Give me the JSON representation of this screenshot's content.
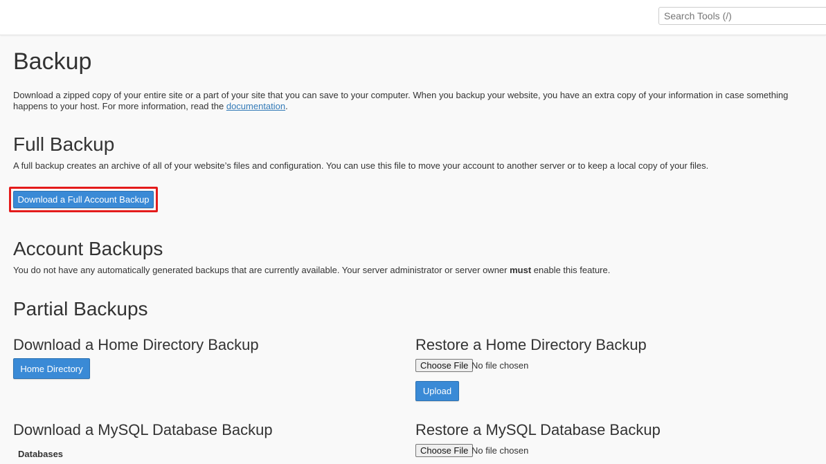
{
  "header": {
    "search_placeholder": "Search Tools (/)"
  },
  "page": {
    "title": "Backup",
    "intro_text": "Download a zipped copy of your entire site or a part of your site that you can save to your computer. When you backup your website, you have an extra copy of your information in case something",
    "intro_text_line2": "happens to your host. For more information, read the ",
    "intro_link": "documentation",
    "intro_end": "."
  },
  "full_backup": {
    "heading": "Full Backup",
    "description": "A full backup creates an archive of all of your website’s files and configuration. You can use this file to move your account to another server or to keep a local copy of your files.",
    "button_label": "Download a Full Account Backup"
  },
  "account_backups": {
    "heading": "Account Backups",
    "text_before": "You do not have any automatically generated backups that are currently available. Your server administrator or server owner ",
    "text_bold": "must",
    "text_after": " enable this feature."
  },
  "partial_backups": {
    "heading": "Partial Backups",
    "home_download_heading": "Download a Home Directory Backup",
    "home_button_label": "Home Directory",
    "home_restore_heading": "Restore a Home Directory Backup",
    "choose_file_label": "Choose File",
    "no_file_text": "No file chosen",
    "upload_label": "Upload",
    "mysql_download_heading": "Download a MySQL Database Backup",
    "databases_label": "Databases",
    "mysql_restore_heading": "Restore a MySQL Database Backup"
  },
  "colors": {
    "primary_button": "#3a8ad6",
    "highlight_border": "#e41b1b",
    "link": "#337ab7"
  }
}
